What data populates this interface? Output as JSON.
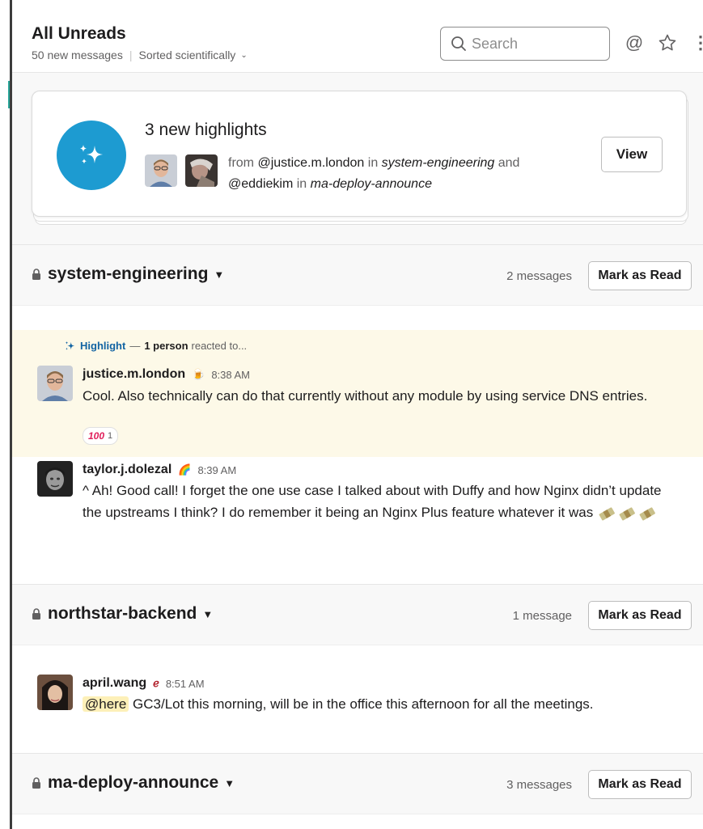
{
  "header": {
    "title": "All Unreads",
    "subtitle_count": "50 new messages",
    "subtitle_sort": "Sorted scientifically",
    "search_placeholder": "Search"
  },
  "highlights": {
    "title": "3 new highlights",
    "from_word": "from",
    "user1": "@justice.m.london",
    "in1": "in",
    "channel1": "system-engineering",
    "and_word": "and",
    "user2": "@eddiekim",
    "in2": "in",
    "channel2": "ma-deploy-announce",
    "view_label": "View"
  },
  "channels": [
    {
      "name": "system-engineering",
      "count": "2 messages",
      "mark_label": "Mark as Read",
      "highlight": {
        "label": "Highlight",
        "dash": "—",
        "people": "1 person",
        "suffix": "reacted to..."
      },
      "messages": [
        {
          "user": "justice.m.london",
          "time": "8:38 AM",
          "text": "Cool. Also technically can do that currently without any module by using service DNS entries.",
          "reaction_emoji": "100",
          "reaction_count": "1"
        },
        {
          "user": "taylor.j.dolezal",
          "time": "8:39 AM",
          "text": "^ Ah! Good call! I forget the one use case I talked about with Duffy and how Nginx didn’t update the upstreams I think? I do remember it being an Nginx Plus feature whatever it was"
        }
      ]
    },
    {
      "name": "northstar-backend",
      "count": "1 message",
      "mark_label": "Mark as Read",
      "messages": [
        {
          "user": "april.wang",
          "time": "8:51 AM",
          "mention": "@here",
          "text": " GC3/Lot this morning, will be in the office this afternoon for all the meetings."
        }
      ]
    },
    {
      "name": "ma-deploy-announce",
      "count": "3 messages",
      "mark_label": "Mark as Read"
    }
  ],
  "colors": {
    "accent_blue": "#1d9bd1",
    "highlight_bg": "#fdf9e8",
    "link_blue": "#1264a3"
  },
  "icons": [
    "search-icon",
    "at-icon",
    "star-icon",
    "more-icon",
    "sparkle-icon",
    "lock-icon",
    "caret-down-icon",
    "money-emoji-icon"
  ]
}
